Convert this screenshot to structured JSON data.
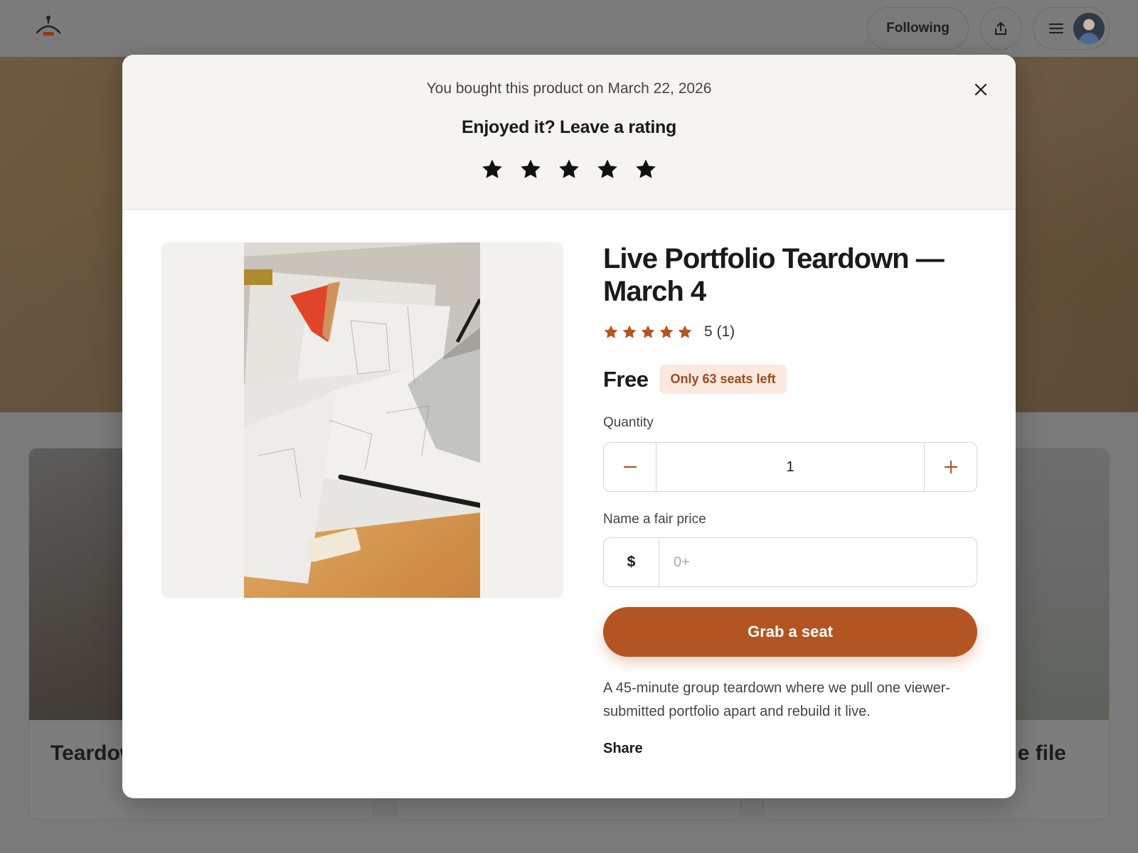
{
  "header": {
    "following_label": "Following",
    "share_icon": "upload-share-icon",
    "menu_icon": "hamburger-menu-icon",
    "logo_icon": "hanger-logo-icon"
  },
  "background_cards": [
    {
      "title": "Teardow"
    },
    {
      "title": ""
    },
    {
      "title": "e file"
    }
  ],
  "modal": {
    "purchase_notice": "You bought this product on March 22, 2026",
    "rating_prompt": "Enjoyed it? Leave a rating",
    "rating_stars": 5,
    "close_icon": "close-icon",
    "product": {
      "title": "Live Portfolio Teardown — March 4",
      "rating_value": 5,
      "rating_text": "5 (1)",
      "price": "Free",
      "seats_badge": "Only 63 seats left",
      "quantity_label": "Quantity",
      "quantity_value": "1",
      "fair_price_label": "Name a fair price",
      "currency_symbol": "$",
      "price_placeholder": "0+",
      "cta_label": "Grab a seat",
      "description": "A 45-minute group teardown where we pull one viewer-submitted portfolio apart and rebuild it live.",
      "share_label": "Share"
    }
  },
  "colors": {
    "accent": "#b35522",
    "badge_bg": "#fbe9df",
    "badge_text": "#9a4a1e",
    "star_filled": "#b35522",
    "rating_star": "#111111"
  }
}
